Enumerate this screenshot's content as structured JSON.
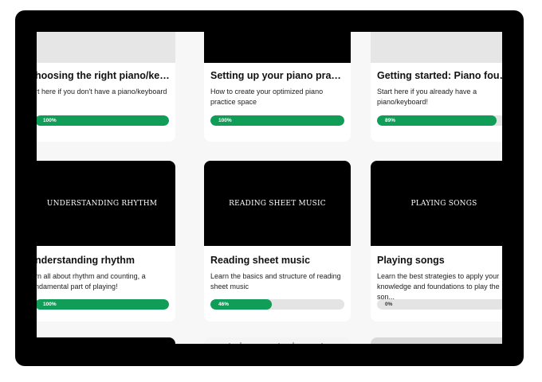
{
  "colors": {
    "progress_fill": "#0f9d58",
    "progress_track": "#e4e4e4",
    "frame": "#000000",
    "page_bg": "#f7f7f7"
  },
  "courses": [
    {
      "title": "hoosing the right piano/keyboard",
      "description": "rt here if you don't have a piano/keyboard !",
      "progress_label": "100%",
      "progress_percent": 100,
      "thumbnail": "light"
    },
    {
      "title": "Setting up your piano practice spa...",
      "description": "How to create your optimized piano practice space",
      "progress_label": "100%",
      "progress_percent": 100,
      "thumbnail": "dark"
    },
    {
      "title": "Getting started: Piano foundations",
      "description": "Start here if you already have a piano/keyboard!",
      "progress_label": "89%",
      "progress_percent": 89,
      "thumbnail": "light"
    },
    {
      "thumbnail_text": "UNDERSTANDING RHYTHM",
      "title": "nderstanding rhythm",
      "description": "rn all about rhythm and counting, a ndamental part of playing!",
      "progress_label": "100%",
      "progress_percent": 100,
      "thumbnail": "dark"
    },
    {
      "thumbnail_text": "READING SHEET MUSIC",
      "title": "Reading sheet music",
      "description": "Learn the basics and structure of reading sheet music",
      "progress_label": "46%",
      "progress_percent": 46,
      "thumbnail": "dark"
    },
    {
      "thumbnail_text": "PLAYING SONGS",
      "title": "Playing songs",
      "description": "Learn the best strategies to apply your knowledge and foundations to play the son...",
      "progress_label": "0%",
      "progress_percent": 0,
      "thumbnail": "dark"
    }
  ],
  "partial_cards": [
    {
      "thumbnail": "dark"
    },
    {
      "thumbnail": "sheet-music"
    },
    {
      "thumbnail": "piano-photo"
    }
  ]
}
